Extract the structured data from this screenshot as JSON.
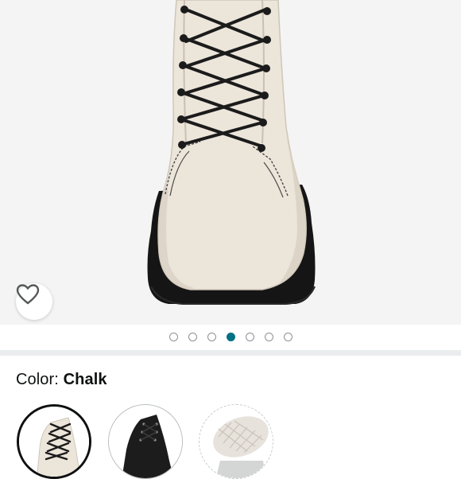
{
  "gallery": {
    "image_icon": "boot-photo",
    "wishlist_icon": "heart-outline-icon",
    "page_count": 7,
    "active_index": 3
  },
  "variation": {
    "label": "Color: ",
    "selected_value": "Chalk",
    "swatches": [
      {
        "icon": "chalk-boot-thumbnail",
        "selected": true
      },
      {
        "icon": "black-boot-thumbnail",
        "selected": false
      },
      {
        "icon": "white-sole-thumbnail",
        "selected": false
      }
    ]
  },
  "colors": {
    "accent": "#007185",
    "text": "#0f1111",
    "background": "#f4f4f4"
  }
}
